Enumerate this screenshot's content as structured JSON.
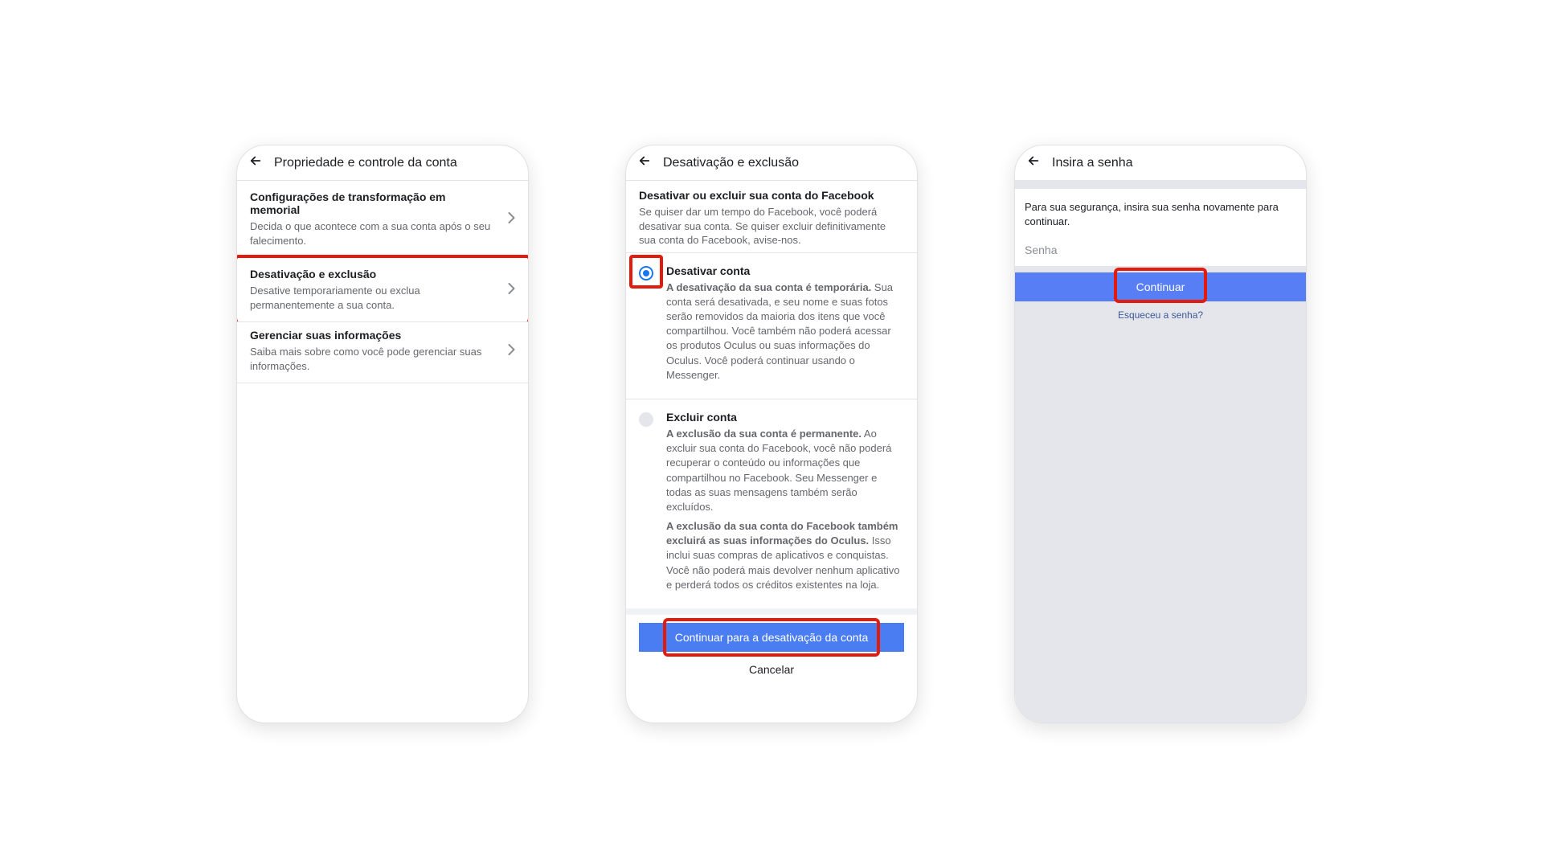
{
  "screen1": {
    "title": "Propriedade e controle da conta",
    "items": [
      {
        "title": "Configurações de transformação em memorial",
        "sub": "Decida o que acontece com a sua conta após o seu falecimento."
      },
      {
        "title": "Desativação e exclusão",
        "sub": "Desative temporariamente ou exclua permanentemente a sua conta."
      },
      {
        "title": "Gerenciar suas informações",
        "sub": "Saiba mais sobre como você pode gerenciar suas informações."
      }
    ]
  },
  "screen2": {
    "title": "Desativação e exclusão",
    "intro_title": "Desativar ou excluir sua conta do Facebook",
    "intro_sub": "Se quiser dar um tempo do Facebook, você poderá desativar sua conta. Se quiser excluir definitivamente sua conta do Facebook, avise-nos.",
    "opt1": {
      "title": "Desativar conta",
      "bold": "A desativação da sua conta é temporária.",
      "text": " Sua conta será desativada, e seu nome e suas fotos serão removidos da maioria dos itens que você compartilhou. Você também não poderá acessar os produtos Oculus ou suas informações do Oculus. Você poderá continuar usando o Messenger."
    },
    "opt2": {
      "title": "Excluir conta",
      "bold1": "A exclusão da sua conta é permanente.",
      "text1": " Ao excluir sua conta do Facebook, você não poderá recuperar o conteúdo ou informações que compartilhou no Facebook. Seu Messenger e todas as suas mensagens também serão excluídos.",
      "bold2": "A exclusão da sua conta do Facebook também excluirá as suas informações do Oculus.",
      "text2": " Isso inclui suas compras de aplicativos e conquistas. Você não poderá mais devolver nenhum aplicativo e perderá todos os créditos existentes na loja."
    },
    "continue_label": "Continuar para a desativação da conta",
    "cancel_label": "Cancelar"
  },
  "screen3": {
    "title": "Insira a senha",
    "prompt": "Para sua segurança, insira sua senha novamente para continuar.",
    "placeholder": "Senha",
    "continue_label": "Continuar",
    "forgot_label": "Esqueceu a senha?"
  }
}
